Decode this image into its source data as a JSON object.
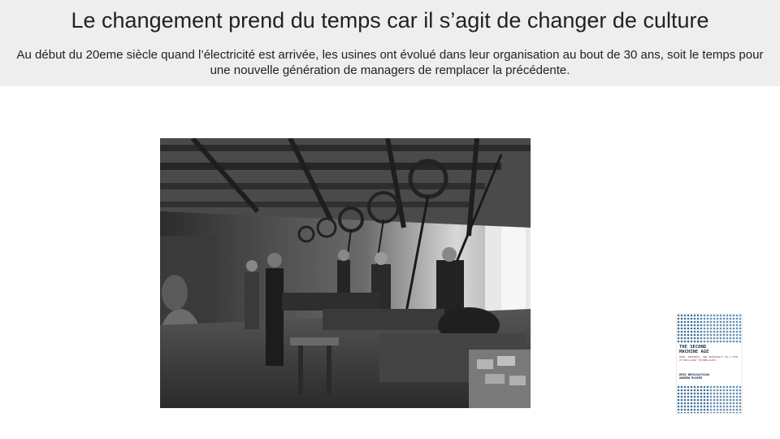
{
  "slide": {
    "title": "Le changement prend du temps car il s’agit de changer de culture",
    "subtitle": "Au début du 20eme siècle quand l’électricité est arrivée, les usines ont évolué dans leur organisation au bout de 30 ans, soit le temps pour une nouvelle génération de managers de remplacer la précédente."
  },
  "book": {
    "title_line1": "THE SECOND",
    "title_line2": "MACHINE AGE",
    "tagline": "WORK, PROGRESS, AND PROSPERITY IN A TIME OF BRILLIANT TECHNOLOGIES",
    "author1": "ERIK BRYNJOLFSSON",
    "author2": "ANDREW McAFEE"
  },
  "images": {
    "photo": "black-and-white historical factory workshop with overhead belt-driven machinery",
    "book_cover": "The Second Machine Age book cover"
  }
}
